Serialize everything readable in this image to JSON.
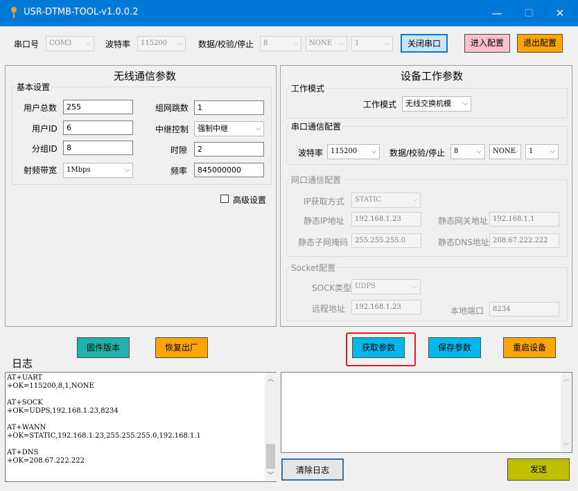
{
  "window": {
    "title": "USR-DTMB-TOOL-v1.0.0.2",
    "minimize": "—",
    "maximize": "☐",
    "close": "✕"
  },
  "serial_bar": {
    "port_label": "串口号",
    "port_value": "COM3",
    "baud_label": "波特率",
    "baud_value": "115200",
    "format_label": "数据/校验/停止",
    "data_bits": "8",
    "parity": "NONE",
    "stop_bits": "1",
    "close_port_label": "关闭串口",
    "enter_config_label": "进入配置",
    "exit_config_label": "退出配置"
  },
  "wireless": {
    "title": "无线通信参数",
    "basic_group": "基本设置",
    "total_users_label": "用户总数",
    "total_users": "255",
    "hops_label": "组网跳数",
    "hops": "1",
    "user_id_label": "用户ID",
    "user_id": "6",
    "relay_label": "中继控制",
    "relay": "强制中继",
    "group_id_label": "分组ID",
    "group_id": "8",
    "slot_label": "时隙",
    "slot": "2",
    "bandwidth_label": "射频带宽",
    "bandwidth": "1Mbps",
    "freq_label": "频率",
    "freq": "845000000",
    "advanced_label": "高级设置"
  },
  "device": {
    "title": "设备工作参数",
    "mode_group": "工作模式",
    "mode_label": "工作模式",
    "mode_value": "无线交换机模",
    "serial_group": "串口通信配置",
    "baud_label": "波特率",
    "baud": "115200",
    "format_label": "数据/校验/停止",
    "data_bits": "8",
    "parity": "NONE",
    "stop_bits": "1",
    "net_group": "网口通信配置",
    "ip_mode_label": "IP获取方式",
    "ip_mode": "STATIC",
    "ip_label": "静态IP地址",
    "ip": "192.168.1.23",
    "gateway_label": "静态网关地址",
    "gateway": "192.168.1.1",
    "mask_label": "静态子网掩码",
    "mask": "255.255.255.0",
    "dns_label": "静态DNS地址",
    "dns": "208.67.222.222",
    "socket_group": "Socket配置",
    "sock_type_label": "SOCK类型",
    "sock_type": "UDPS",
    "remote_label": "远程地址",
    "remote": "192.168.1.23",
    "local_port_label": "本地端口",
    "local_port": "8234"
  },
  "actions": {
    "firmware": "固件版本",
    "factory_reset": "恢复出厂",
    "get_params": "获取参数",
    "save_params": "保存参数",
    "restart": "重启设备"
  },
  "log": {
    "title": "日志",
    "lines": "AT+UART\n+OK=115200,8,1,NONE\n\nAT+SOCK\n+OK=UDPS,192.168.1.23,8234\n\nAT+WANN\n+OK=STATIC,192.168.1.23,255.255.255.0,192.168.1.1\n\nAT+DNS\n+OK=208.67.222.222",
    "clear_label": "清除日志",
    "send_label": "发送"
  },
  "colors": {
    "titlebar": "#0078d7",
    "cyan_button": "#00b7eb",
    "orange_button": "#ffa500",
    "pink_button": "#ffc0cb",
    "olive_button": "#c0c000",
    "light_blue_button": "#cce4f7",
    "highlight_border": "#e02020"
  }
}
